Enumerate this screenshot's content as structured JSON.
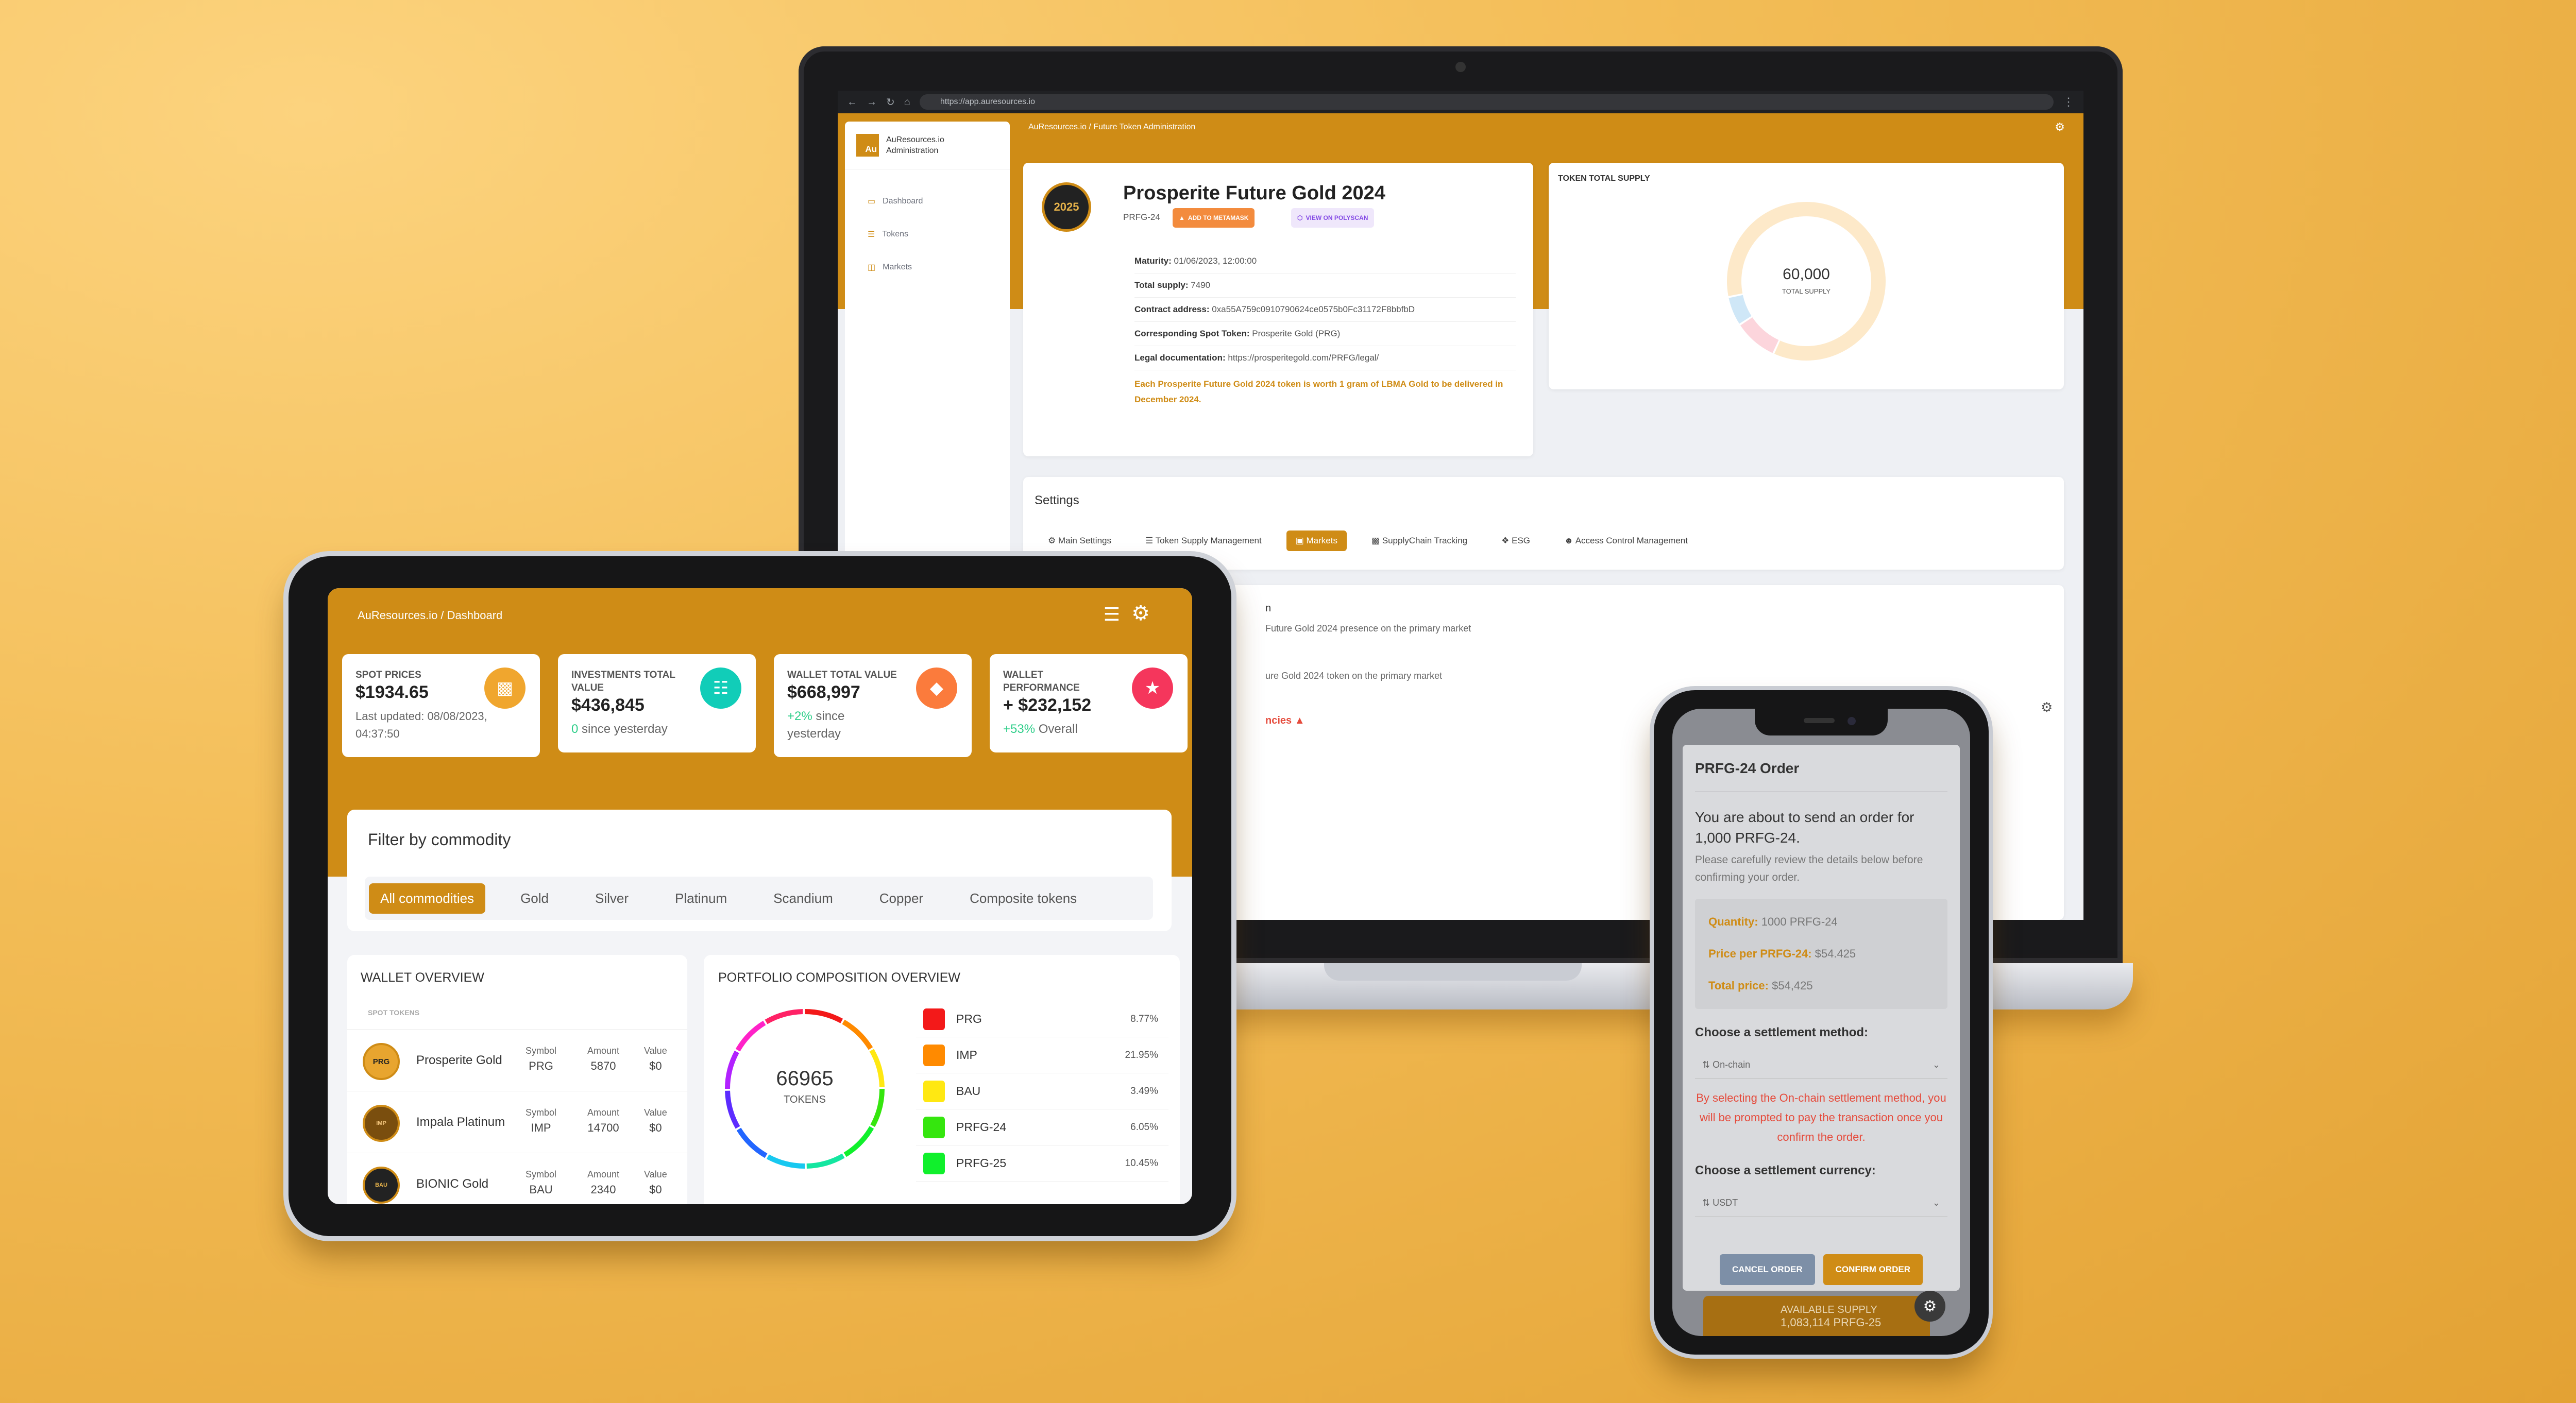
{
  "colors": {
    "accent": "#cf8c16",
    "background": "#f3bd57",
    "screen_bg": "#f3f4f7",
    "danger": "#e54b3c",
    "positive": "#2dce89"
  },
  "laptop": {
    "browser": {
      "url": "https://app.auresources.io"
    },
    "sidebar": {
      "brand": "AuResources.io Administration",
      "logo": "Au",
      "items": [
        {
          "icon": "dashboard-icon",
          "label": "Dashboard"
        },
        {
          "icon": "tokens-icon",
          "label": "Tokens"
        },
        {
          "icon": "markets-icon",
          "label": "Markets"
        }
      ]
    },
    "breadcrumb": "AuResources.io  /  Future Token Administration",
    "token": {
      "icon_text": "2025",
      "name": "Prosperite Future Gold 2024",
      "symbol": "PRFG-24",
      "metamask_label": "ADD TO METAMASK",
      "polyscan_label": "VIEW ON POLYSCAN",
      "rows": [
        {
          "label": "Maturity:",
          "value": "01/06/2023, 12:00:00"
        },
        {
          "label": "Total supply:",
          "value": "7490"
        },
        {
          "label": "Contract address:",
          "value": "0xa55A759c0910790624ce0575b0Fc31172F8bbfbD"
        },
        {
          "label": "Corresponding Spot Token:",
          "value": "Prosperite Gold (PRG)"
        },
        {
          "label": "Legal documentation:",
          "value": "https://prosperitegold.com/PRFG/legal/"
        }
      ],
      "note": "Each Prosperite Future Gold 2024 token is worth 1 gram of LBMA Gold to be delivered in December 2024."
    },
    "supply": {
      "title": "TOKEN TOTAL SUPPLY",
      "value": "60,000",
      "label": "TOTAL SUPPLY",
      "segments": [
        {
          "fraction": 0.85,
          "color": "#fde9c9"
        },
        {
          "fraction": 0.09,
          "color": "#fcd5dc"
        },
        {
          "fraction": 0.06,
          "color": "#cfe7f7"
        }
      ]
    },
    "settings": {
      "title": "Settings",
      "tabs": [
        {
          "icon": "gear-icon",
          "label": "Main Settings",
          "active": false
        },
        {
          "icon": "layers-icon",
          "label": "Token Supply Management",
          "active": false
        },
        {
          "icon": "market-icon",
          "label": "Markets",
          "active": true
        },
        {
          "icon": "chart-icon",
          "label": "SupplyChain Tracking",
          "active": false
        },
        {
          "icon": "leaf-icon",
          "label": "ESG",
          "active": false
        },
        {
          "icon": "users-icon",
          "label": "Access Control Management",
          "active": false
        }
      ]
    },
    "lower": {
      "fragment1": "n",
      "fragment2": "Future Gold 2024 presence on the primary market",
      "fragment3": "ure Gold 2024 token on the primary market",
      "fragment4": "ncies"
    }
  },
  "tablet": {
    "breadcrumb": "AuResources.io  /  Dashboard",
    "stats": [
      {
        "title": "SPOT PRICES",
        "value": "$1934.65",
        "sub": "Last updated: 08/08/2023, 04:37:50",
        "icon": "money-icon",
        "color": "#f0a62e"
      },
      {
        "title": "INVESTMENTS TOTAL VALUE",
        "value": "$436,845",
        "change": "0",
        "sub": "since yesterday",
        "icon": "document-icon",
        "color": "#11cdb8"
      },
      {
        "title": "WALLET TOTAL VALUE",
        "value": "$668,997",
        "change": "+2%",
        "sub": "since yesterday",
        "icon": "diamond-icon",
        "color": "#fb7b3c"
      },
      {
        "title": "WALLET PERFORMANCE",
        "value": "+ $232,152",
        "change": "+53%",
        "sub": "Overall",
        "icon": "trophy-icon",
        "color": "#f5365c"
      }
    ],
    "filter": {
      "title": "Filter by commodity",
      "chips": [
        "All commodities",
        "Gold",
        "Silver",
        "Platinum",
        "Scandium",
        "Copper",
        "Composite tokens"
      ],
      "active": 0
    },
    "wallet": {
      "title": "WALLET OVERVIEW",
      "subtitle": "SPOT TOKENS",
      "col_symbol": "Symbol",
      "col_amount": "Amount",
      "col_value": "Value",
      "rows": [
        {
          "avatar": "PRG",
          "name": "Prosperite Gold",
          "symbol": "PRG",
          "amount": "5870",
          "value": "$0"
        },
        {
          "avatar": "IMP",
          "name": "Impala Platinum",
          "symbol": "IMP",
          "amount": "14700",
          "value": "$0"
        },
        {
          "avatar": "BAU",
          "name": "BIONIC Gold",
          "symbol": "BAU",
          "amount": "2340",
          "value": "$0"
        }
      ]
    },
    "portfolio": {
      "title": "PORTFOLIO COMPOSITION OVERVIEW",
      "total": "66965",
      "unit": "TOKENS",
      "legend": [
        {
          "name": "PRG",
          "pct": "8.77%",
          "color": "#f31919"
        },
        {
          "name": "IMP",
          "pct": "21.95%",
          "color": "#ff8a00"
        },
        {
          "name": "BAU",
          "pct": "3.49%",
          "color": "#ffe812"
        },
        {
          "name": "PRFG-24",
          "pct": "6.05%",
          "color": "#35e60e"
        },
        {
          "name": "PRFG-25",
          "pct": "10.45%",
          "color": "#10f02c"
        }
      ],
      "ring_colors": [
        "#f31919",
        "#ff8a00",
        "#ffe812",
        "#35e60e",
        "#10f02c",
        "#14e6a0",
        "#18c8f0",
        "#2266ff",
        "#5c2cff",
        "#b222ff",
        "#ff22c8",
        "#ff2266"
      ]
    }
  },
  "phone": {
    "title": "PRFG-24 Order",
    "headline": "You are about to send an order for 1,000 PRFG-24.",
    "instructions": "Please carefully review the details below before confirming your order.",
    "details": [
      {
        "label": "Quantity:",
        "value": "1000 PRFG-24"
      },
      {
        "label": "Price per PRFG-24:",
        "value": "$54.425"
      },
      {
        "label": "Total price:",
        "value": "$54,425"
      }
    ],
    "method_q": "Choose a settlement method:",
    "method_value": "On-chain",
    "warning": "By selecting the On-chain settlement method, you will be prompted to pay the transaction once you confirm the order.",
    "currency_q": "Choose a settlement currency:",
    "currency_value": "USDT",
    "cancel": "CANCEL ORDER",
    "confirm": "CONFIRM ORDER",
    "bg_label": "AVAILABLE SUPPLY",
    "bg_value": "1,083,114 PRFG-25",
    "bg_icon": "2025"
  }
}
